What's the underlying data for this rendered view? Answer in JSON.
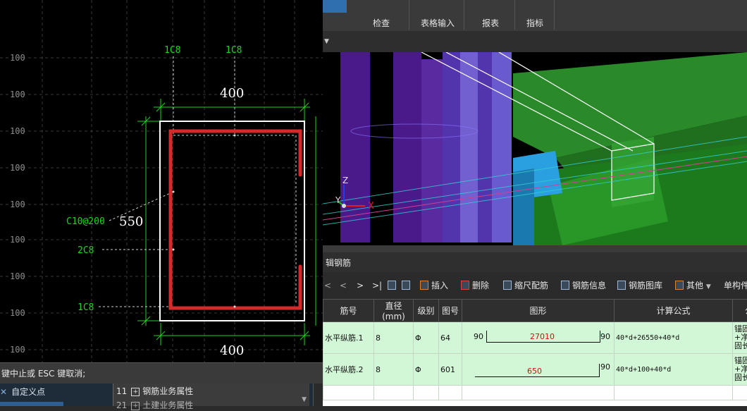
{
  "cad": {
    "row_labels": [
      "100",
      "100",
      "100",
      "100",
      "100",
      "100",
      "100",
      "100",
      "100"
    ],
    "top_labels": [
      "1C8",
      "1C8"
    ],
    "dim_top": "400",
    "dim_bottom": "400",
    "dim_side": "550",
    "stirrup_label": "C10@200",
    "side_bar_label": "2C8",
    "bottom_bar_label": "1C8",
    "colors": {
      "dim": "#19d819",
      "rebar": "#d42a2a",
      "section": "#ffffff"
    }
  },
  "command_line": "键中止或 ESC 键取消;",
  "left_bottom": {
    "custom_point": "自定义点",
    "attr_row_num": "11",
    "attr_row_label": "钢筋业务属性",
    "attr_row2_num": "21",
    "attr_row2_label": "土建业务属性"
  },
  "ribbon": {
    "groups": [
      "检查",
      "表格输入",
      "报表",
      "指标"
    ]
  },
  "view3d": {
    "axis_x": "X",
    "axis_y": "Y",
    "axis_z": "Z"
  },
  "editor": {
    "title": "辑钢筋",
    "nav": [
      "<",
      "<",
      ">",
      ">|"
    ],
    "toolbar": [
      "插入",
      "删除",
      "缩尺配筋",
      "钢筋信息",
      "钢筋图库",
      "其他",
      "单构件"
    ],
    "columns": [
      "筋号",
      "直径(mm)",
      "级别",
      "图号",
      "图形",
      "计算公式",
      "公式"
    ],
    "rows": [
      {
        "name": "水平纵筋.1",
        "diameter": "8",
        "grade": "Φ",
        "fig_no": "64",
        "left": "90",
        "length": "27010",
        "right": "90",
        "formula": "40*d+26550+40*d",
        "desc1": "锚固",
        "desc2": "+净",
        "desc3": "固长"
      },
      {
        "name": "水平纵筋.2",
        "diameter": "8",
        "grade": "Φ",
        "fig_no": "601",
        "left": "",
        "length": "650",
        "right": "90",
        "formula": "40*d+100+40*d",
        "desc1": "锚固",
        "desc2": "+净",
        "desc3": "固长"
      }
    ]
  }
}
